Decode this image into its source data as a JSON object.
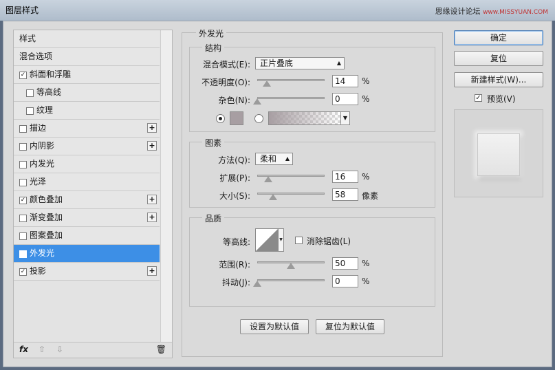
{
  "window": {
    "title": "图层样式",
    "watermark": "思缘设计论坛",
    "watermark_site": "www.MISSYUAN.COM"
  },
  "styles": {
    "header": "样式",
    "blend_options": "混合选项",
    "items": [
      {
        "label": "斜面和浮雕",
        "checked": "✓",
        "plus": ""
      },
      {
        "label": "等高线",
        "checked": "",
        "plus": ""
      },
      {
        "label": "纹理",
        "checked": "",
        "plus": ""
      },
      {
        "label": "描边",
        "checked": "",
        "plus": "+"
      },
      {
        "label": "内阴影",
        "checked": "",
        "plus": "+"
      },
      {
        "label": "内发光",
        "checked": "",
        "plus": ""
      },
      {
        "label": "光泽",
        "checked": "",
        "plus": ""
      },
      {
        "label": "颜色叠加",
        "checked": "✓",
        "plus": "+"
      },
      {
        "label": "渐变叠加",
        "checked": "",
        "plus": "+"
      },
      {
        "label": "图案叠加",
        "checked": "",
        "plus": ""
      },
      {
        "label": "外发光",
        "checked": "✓",
        "plus": ""
      },
      {
        "label": "投影",
        "checked": "✓",
        "plus": "+"
      }
    ],
    "bottom": {
      "fx": "fx",
      "up": "⇧",
      "down": "⇩",
      "trash": "🗑"
    }
  },
  "outer_glow": {
    "title": "外发光",
    "structure": {
      "title": "结构",
      "blend_mode_label": "混合模式(E):",
      "blend_mode_value": "正片叠底",
      "opacity_label": "不透明度(O):",
      "opacity_value": "14",
      "opacity_fraction": 0.14,
      "noise_label": "杂色(N):",
      "noise_value": "0",
      "noise_fraction": 0.0,
      "percent": "%",
      "glow_color": "#a79ea2"
    },
    "elements": {
      "title": "图素",
      "technique_label": "方法(Q):",
      "technique_value": "柔和",
      "spread_label": "扩展(P):",
      "spread_value": "16",
      "spread_fraction": 0.16,
      "size_label": "大小(S):",
      "size_value": "58",
      "size_fraction": 0.23,
      "size_unit": "像素",
      "percent": "%"
    },
    "quality": {
      "title": "品质",
      "contour_label": "等高线:",
      "antialias_label": "消除锯齿(L)",
      "range_label": "范围(R):",
      "range_value": "50",
      "range_fraction": 0.5,
      "jitter_label": "抖动(J):",
      "jitter_value": "0",
      "jitter_fraction": 0.0,
      "percent": "%"
    },
    "buttons": {
      "make_default": "设置为默认值",
      "reset_default": "复位为默认值"
    }
  },
  "actions": {
    "ok": "确定",
    "reset": "复位",
    "new_style": "新建样式(W)...",
    "preview_label": "预览(V)",
    "preview_checked": "✓"
  },
  "colors": {
    "accent": "#3d8fe6",
    "dialog_bg": "#dadada"
  }
}
